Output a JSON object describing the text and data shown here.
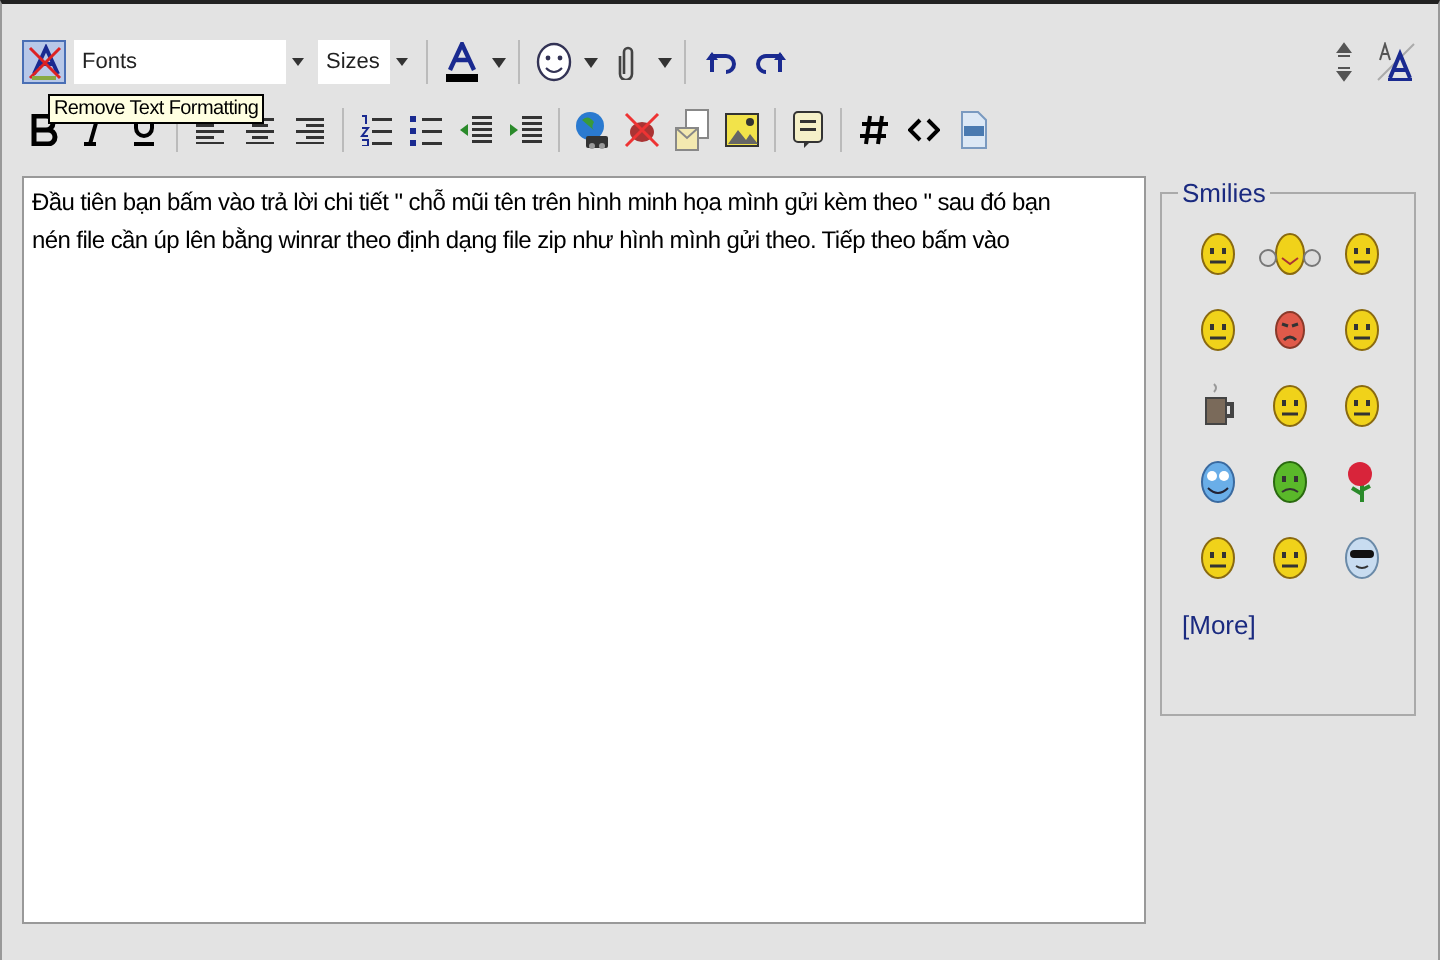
{
  "toolbar_row_1": {
    "remove_format": {
      "selected": true
    },
    "font_select": {
      "value": "Fonts"
    },
    "size_select": {
      "value": "Sizes"
    }
  },
  "tooltip": "Remove Text Formatting",
  "editor": {
    "lines": [
      "Đầu tiên bạn bấm vào trả lời chi tiết \" chỗ mũi tên trên hình minh họa mình gửi kèm theo \" sau đó bạn",
      "nén file cần úp lên bằng winrar theo định dạng file zip như hình mình gửi theo. Tiếp theo bấm vào"
    ]
  },
  "smilies": {
    "title": "Smilies",
    "items": [
      {
        "kind": "face"
      },
      {
        "kind": "thumbs"
      },
      {
        "kind": "face"
      },
      {
        "kind": "face"
      },
      {
        "kind": "angry"
      },
      {
        "kind": "face"
      },
      {
        "kind": "mug"
      },
      {
        "kind": "face"
      },
      {
        "kind": "face"
      },
      {
        "kind": "blue"
      },
      {
        "kind": "green"
      },
      {
        "kind": "rose"
      },
      {
        "kind": "face"
      },
      {
        "kind": "face"
      },
      {
        "kind": "cool"
      }
    ],
    "more": "[More]"
  }
}
